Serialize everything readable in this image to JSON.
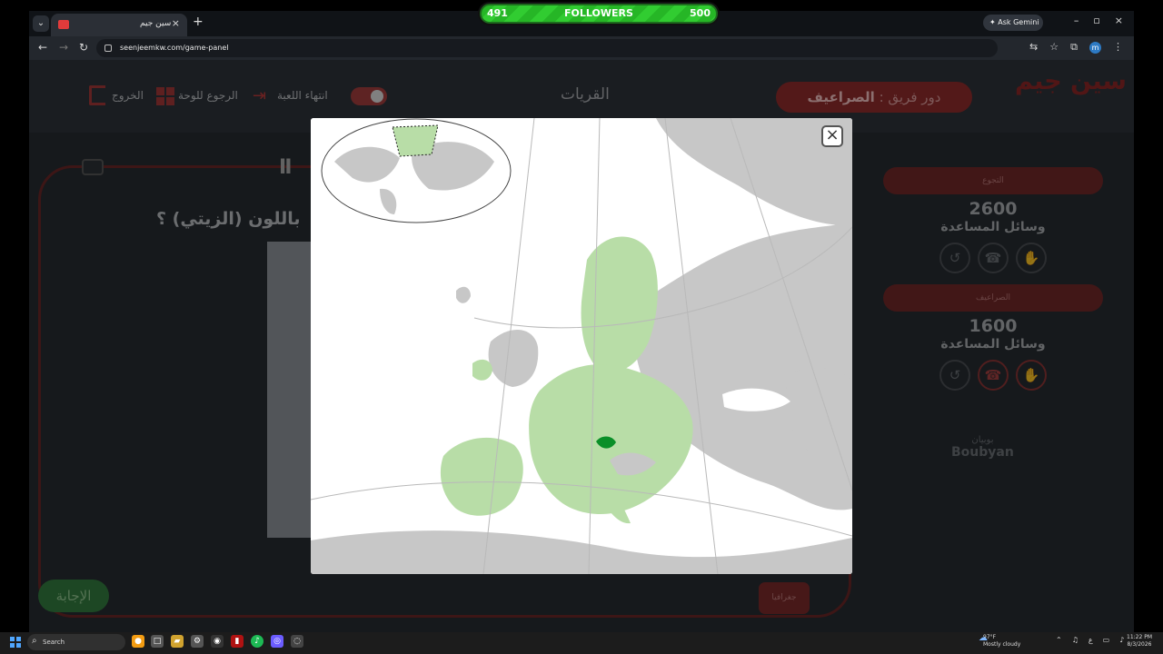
{
  "followers": {
    "label": "FOLLOWERS",
    "current": "491",
    "target": "500"
  },
  "browser": {
    "tab_title": "سين جيم",
    "address": "seenjeemkw.com/game-panel",
    "ask_label": "Ask Gemini",
    "profile_letter": "m"
  },
  "header": {
    "logo": "سين جيم",
    "team_prefix": "دور فريق :",
    "team_name": "الصراعيف",
    "category": "القريات",
    "end_game": "انتهاء اللعبة",
    "back_to_board": "الرجوع للوحة",
    "exit": "الخروج"
  },
  "question": {
    "text": "باللون (الزيتي) ؟",
    "answer_button": "الإجابة",
    "category_tag": "جغرافيا"
  },
  "teams": [
    {
      "name": "التجوع",
      "score": "2600",
      "helpers_label": "وسائل المساعدة"
    },
    {
      "name": "الصراعيف",
      "score": "1600",
      "helpers_label": "وسائل المساعدة"
    }
  ],
  "sponsor": {
    "arabic": "بوبيان",
    "english": "Boubyan"
  },
  "taskbar": {
    "search": "Search",
    "temperature": "97°F",
    "weather": "Mostly cloudy",
    "time": "11:22 PM",
    "date": "8/3/2026"
  },
  "colors": {
    "page_bg": "#262b31",
    "accent_red": "#8f2b2b",
    "map_eu": "#b8dda7",
    "map_selected": "#0a8f28",
    "map_other": "#c7c7c7"
  },
  "icons": [
    "tab-list-icon",
    "close-icon",
    "plus-icon",
    "back-icon",
    "forward-icon",
    "reload-icon",
    "translate-icon",
    "star-icon",
    "extension-icon",
    "menu-icon",
    "toggle-icon",
    "arrow-icon",
    "grid-icon",
    "door-icon",
    "pause-icon",
    "keyboard-icon",
    "phone-icon",
    "hand-icon",
    "swap-icon",
    "windows-icon",
    "cloud-icon"
  ]
}
